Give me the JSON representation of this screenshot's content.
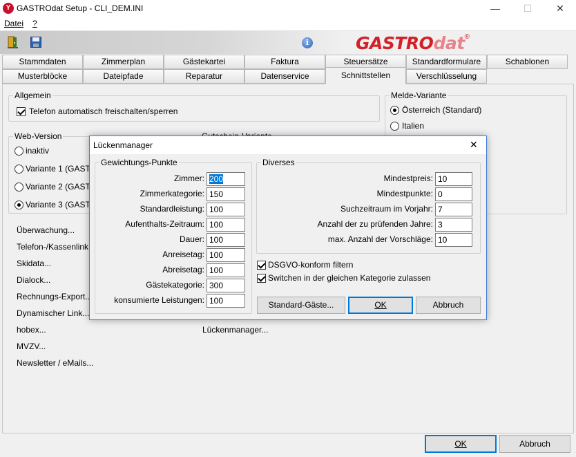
{
  "window": {
    "title": "GASTROdat Setup - CLI_DEM.INI",
    "app_icon": "gastrodat-y-icon"
  },
  "window_controls": {
    "minimize": "—",
    "maximize": "☐",
    "close": "✕"
  },
  "menu": {
    "file": "Datei",
    "help": "?"
  },
  "toolbar": {
    "tools": [
      "exit-door-icon",
      "save-disk-icon"
    ],
    "info_icon": "i",
    "logo_part1": "GASTRO",
    "logo_part2": "dat",
    "logo_reg": "®",
    "logo_color_main": "#d42027",
    "logo_color_light": "#e8838a"
  },
  "tabs_row1": [
    "Stammdaten",
    "Zimmerplan",
    "Gästekartei",
    "Faktura",
    "Steuersätze",
    "Standardformulare",
    "Schablonen"
  ],
  "tabs_row2": [
    "Musterblöcke",
    "Dateipfade",
    "Reparatur",
    "Datenservice",
    "Schnittstellen",
    "Verschlüsselung"
  ],
  "active_tab": "Schnittstellen",
  "panel": {
    "allgemein_label": "Allgemein",
    "telefon_checkbox": "Telefon automatisch freischalten/sperren",
    "telefon_checked": true,
    "melde_label": "Melde-Variante",
    "melde_options": [
      "Österreich (Standard)",
      "Italien"
    ],
    "melde_selected": 0,
    "web_label": "Web-Version",
    "web_options": [
      "inaktiv",
      "Variante 1 (GASTRO",
      "Variante 2 (GASTRO",
      "Variante 3 (GASTRO"
    ],
    "web_selected": 3,
    "gutschein_partial": "Gutschein-Variante",
    "links": [
      "Überwachung...",
      "Telefon-/Kassenlink...",
      "Skidata...",
      "Dialock...",
      "Rechnungs-Export...",
      "Dynamischer Link...",
      "hobex...",
      "MVZV...",
      "Newsletter / eMails..."
    ],
    "lueckenmanager_link": "Lückenmanager..."
  },
  "dialog": {
    "title": "Lückenmanager",
    "close": "✕",
    "gewichtung_label": "Gewichtungs-Punkte",
    "gewichtung": [
      {
        "label": "Zimmer:",
        "value": "200"
      },
      {
        "label": "Zimmerkategorie:",
        "value": "150"
      },
      {
        "label": "Standardleistung:",
        "value": "100"
      },
      {
        "label": "Aufenthalts-Zeitraum:",
        "value": "100"
      },
      {
        "label": "Dauer:",
        "value": "100"
      },
      {
        "label": "Anreisetag:",
        "value": "100"
      },
      {
        "label": "Abreisetag:",
        "value": "100"
      },
      {
        "label": "Gästekategorie:",
        "value": "300"
      },
      {
        "label": "konsumierte Leistungen:",
        "value": "100"
      }
    ],
    "diverses_label": "Diverses",
    "diverses": [
      {
        "label": "Mindestpreis:",
        "value": "10"
      },
      {
        "label": "Mindestpunkte:",
        "value": "0"
      },
      {
        "label": "Suchzeitraum im Vorjahr:",
        "value": "7"
      },
      {
        "label": "Anzahl der zu prüfenden Jahre:",
        "value": "3"
      },
      {
        "label": "max. Anzahl der Vorschläge:",
        "value": "10"
      }
    ],
    "dsgvo_checkbox": "DSGVO-konform filtern",
    "switch_checkbox": "Switchen in der gleichen Kategorie zulassen",
    "dsgvo_checked": true,
    "switch_checked": true,
    "btn_standard": "Standard-Gäste...",
    "btn_ok": "OK",
    "btn_cancel": "Abbruch"
  },
  "footer": {
    "ok": "OK",
    "cancel": "Abbruch"
  }
}
